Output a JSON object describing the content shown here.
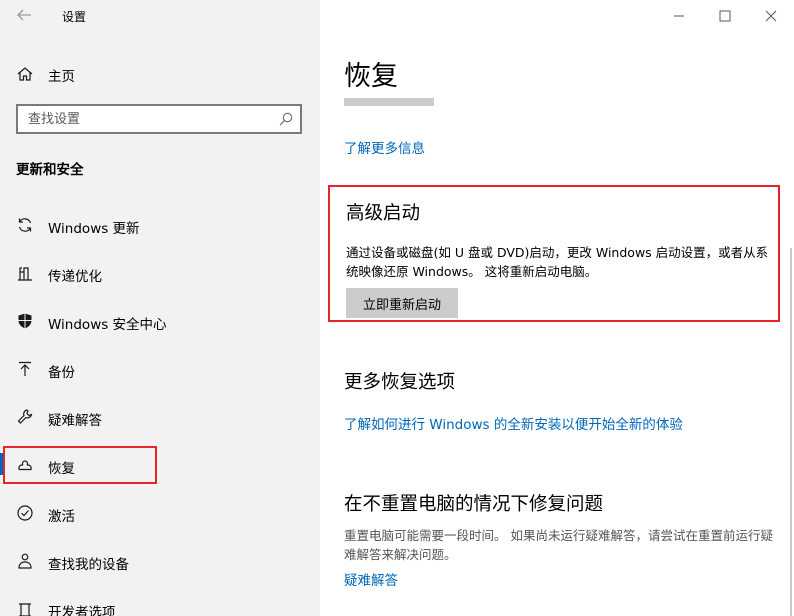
{
  "window": {
    "app_title": "设置",
    "controls": [
      "minimize",
      "maximize",
      "close"
    ]
  },
  "sidebar": {
    "home_label": "主页",
    "search": {
      "placeholder": "查找设置",
      "value": ""
    },
    "section_heading": "更新和安全",
    "items": [
      {
        "label": "Windows 更新",
        "icon": "sync-icon",
        "selected": false
      },
      {
        "label": "传递优化",
        "icon": "delivery-optimization-icon",
        "selected": false
      },
      {
        "label": "Windows 安全中心",
        "icon": "shield-icon",
        "selected": false
      },
      {
        "label": "备份",
        "icon": "backup-arrow-icon",
        "selected": false
      },
      {
        "label": "疑难解答",
        "icon": "wrench-icon",
        "selected": false
      },
      {
        "label": "恢复",
        "icon": "recovery-icon",
        "selected": true
      },
      {
        "label": "激活",
        "icon": "checkmark-circle-icon",
        "selected": false
      },
      {
        "label": "查找我的设备",
        "icon": "person-location-icon",
        "selected": false
      },
      {
        "label": "开发者选项",
        "icon": "developer-tools-icon",
        "selected": false
      }
    ]
  },
  "main": {
    "page_title": "恢复",
    "learn_more_link": "了解更多信息",
    "advanced_startup": {
      "title": "高级启动",
      "description": "通过设备或磁盘(如 U 盘或 DVD)启动，更改 Windows 启动设置，或者从系统映像还原 Windows。 这将重新启动电脑。",
      "button_label": "立即重新启动"
    },
    "more_options": {
      "title": "更多恢复选项",
      "link": "了解如何进行 Windows 的全新安装以便开始全新的体验"
    },
    "fix_problems": {
      "title": "在不重置电脑的情况下修复问题",
      "description": "重置电脑可能需要一段时间。 如果尚未运行疑难解答，请尝试在重置前运行疑难解答来解决问题。",
      "link": "疑难解答"
    }
  },
  "colors": {
    "accent": "#0067c0",
    "link": "#0067b8",
    "highlight_annotation": "#e5252a",
    "sidebar_bg": "#f2f2f2",
    "button_bg": "#cccccc"
  }
}
